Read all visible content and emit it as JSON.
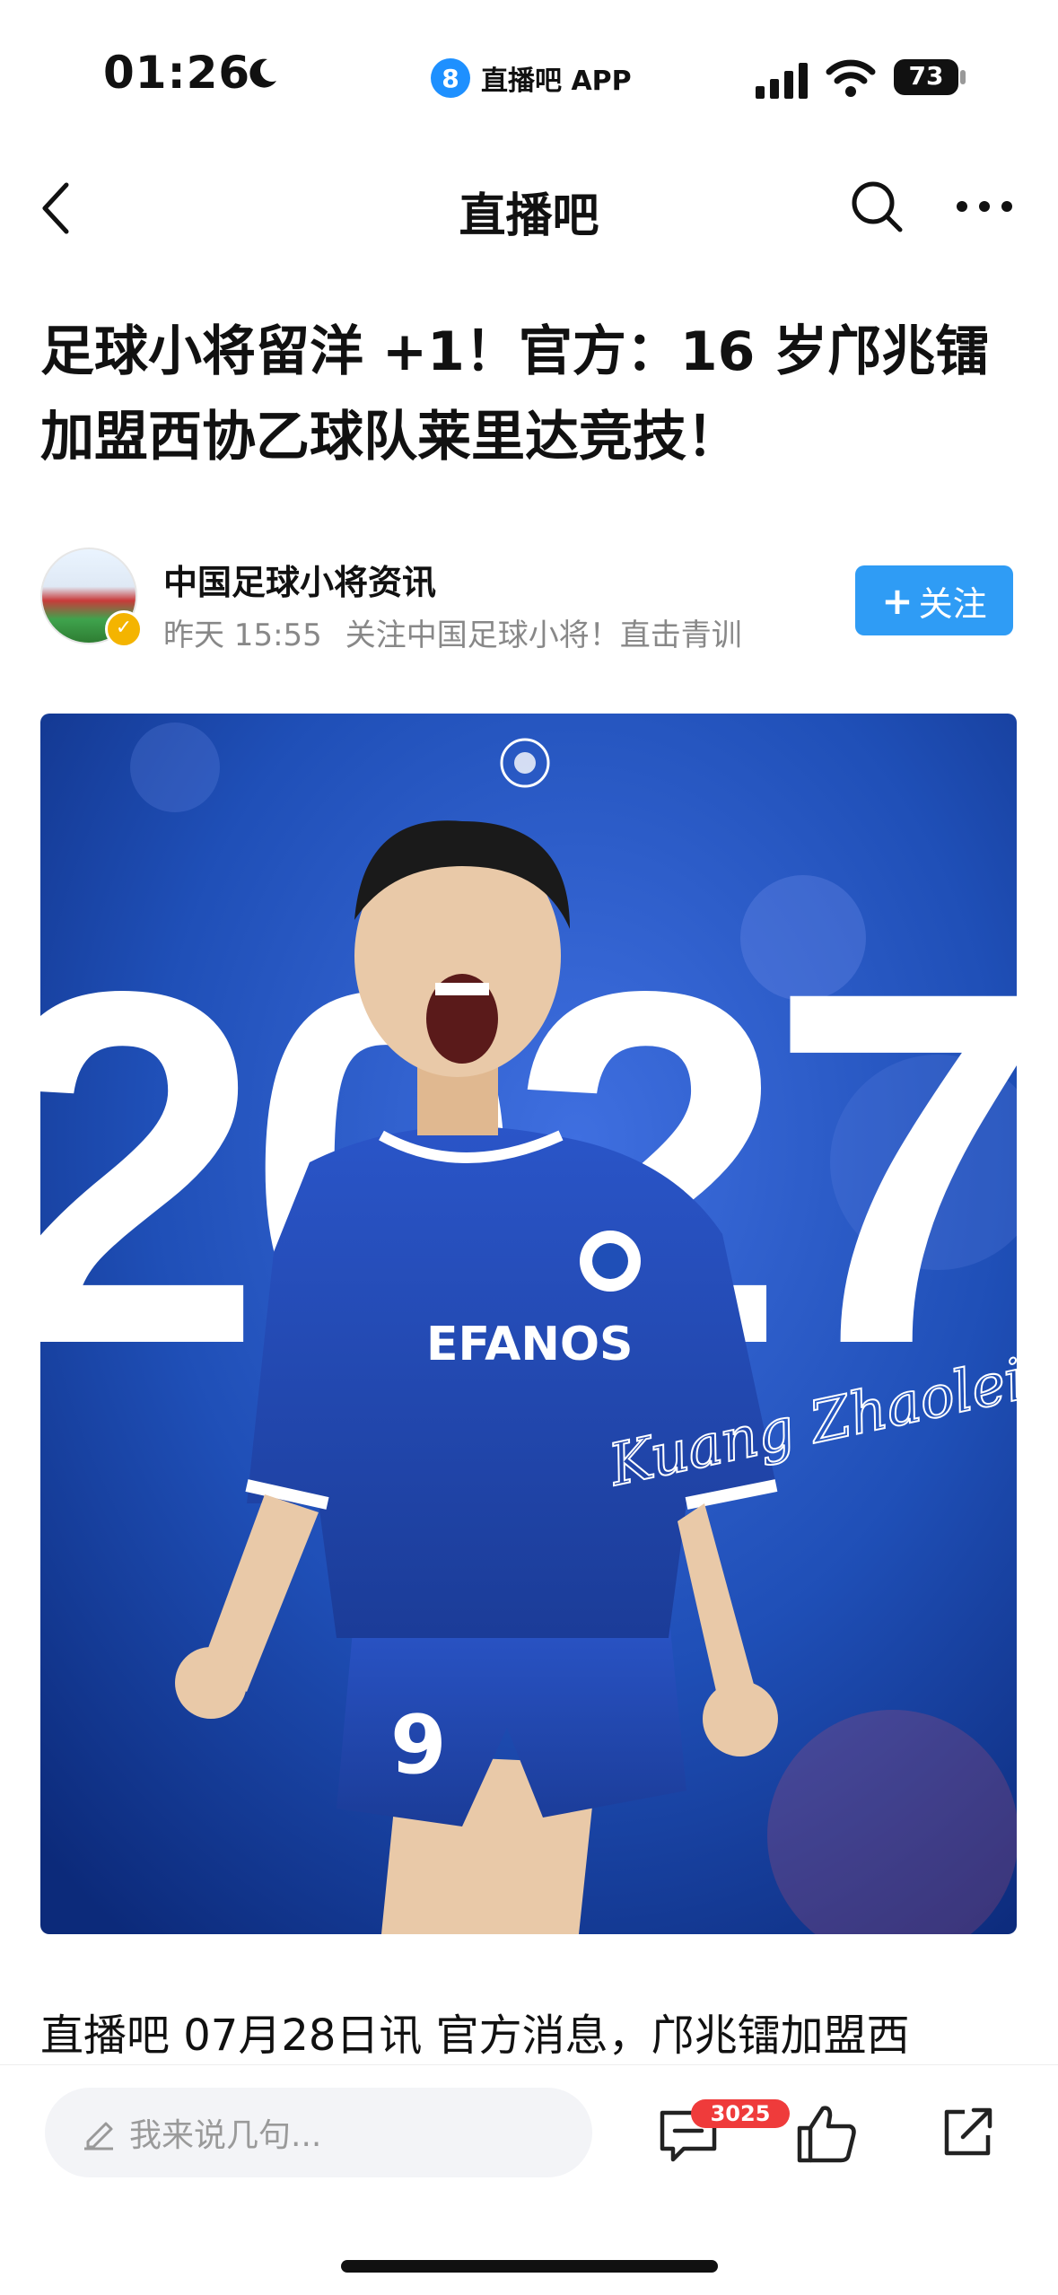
{
  "status_bar": {
    "time": "01:26",
    "app_badge": "8",
    "app_name": "直播吧 APP",
    "battery": "73"
  },
  "nav": {
    "title": "直播吧"
  },
  "article": {
    "title": "足球小将留洋 +1！官方：16 岁邝兆镭加盟西协乙球队莱里达竞技！",
    "author": {
      "name": "中国足球小将资讯",
      "time": "昨天 15:55",
      "bio": "关注中国足球小将！直击青训",
      "follow_label": "关注",
      "follow_plus": "+"
    },
    "hero": {
      "year_text": "2027",
      "shirt_number": "9",
      "signature": "Kuang Zhaolei",
      "sponsor": "EFANOS"
    },
    "lead": "直播吧 07月28日讯  官方消息，邝兆镭加盟西"
  },
  "bottom_bar": {
    "comment_placeholder": "我来说几句...",
    "comment_count": "3025"
  },
  "colors": {
    "accent": "#2f9cf5",
    "badge": "#ef3b3b",
    "hero_blue": "#1f4fb7"
  }
}
